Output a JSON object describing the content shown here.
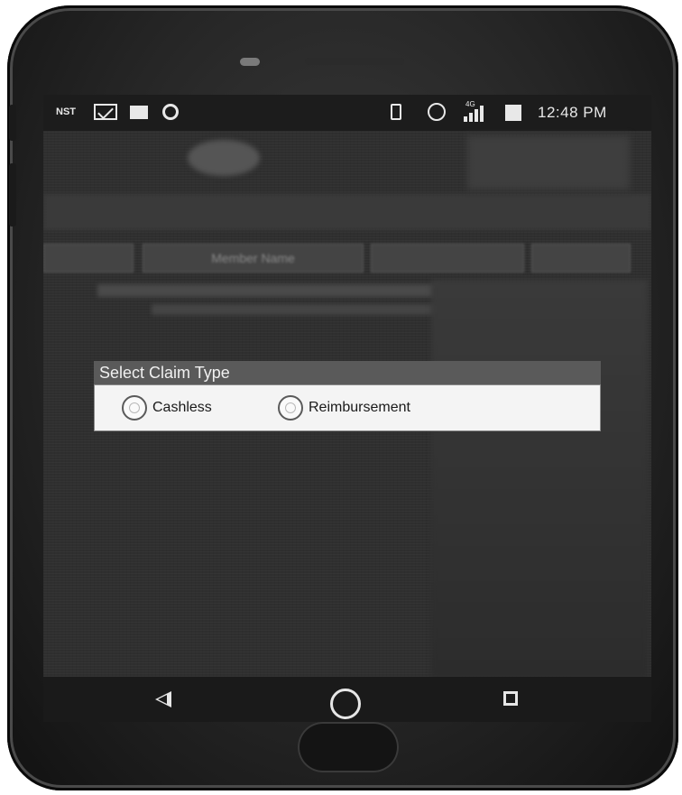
{
  "status_bar": {
    "carrier": "NST",
    "network_label": "4G",
    "time": "12:48 PM",
    "icons": [
      "mail-icon",
      "image-icon",
      "circle-icon",
      "vibrate-icon",
      "alarm-icon",
      "signal-icon",
      "battery-icon"
    ]
  },
  "background_app": {
    "tabs": [
      "",
      "Member Name",
      "",
      ""
    ]
  },
  "dialog": {
    "title": "Select Claim Type",
    "options": [
      {
        "label": "Cashless",
        "selected": false
      },
      {
        "label": "Reimbursement",
        "selected": false
      }
    ]
  },
  "navigation": {
    "icons": [
      "back-icon",
      "home-icon",
      "recent-apps-icon"
    ]
  },
  "colors": {
    "screen_dim": "#2f2f2f",
    "dialog_title_bg": "#5a5a5a",
    "dialog_body_bg": "#f4f4f4",
    "status_bar_bg": "#1c1c1c"
  }
}
